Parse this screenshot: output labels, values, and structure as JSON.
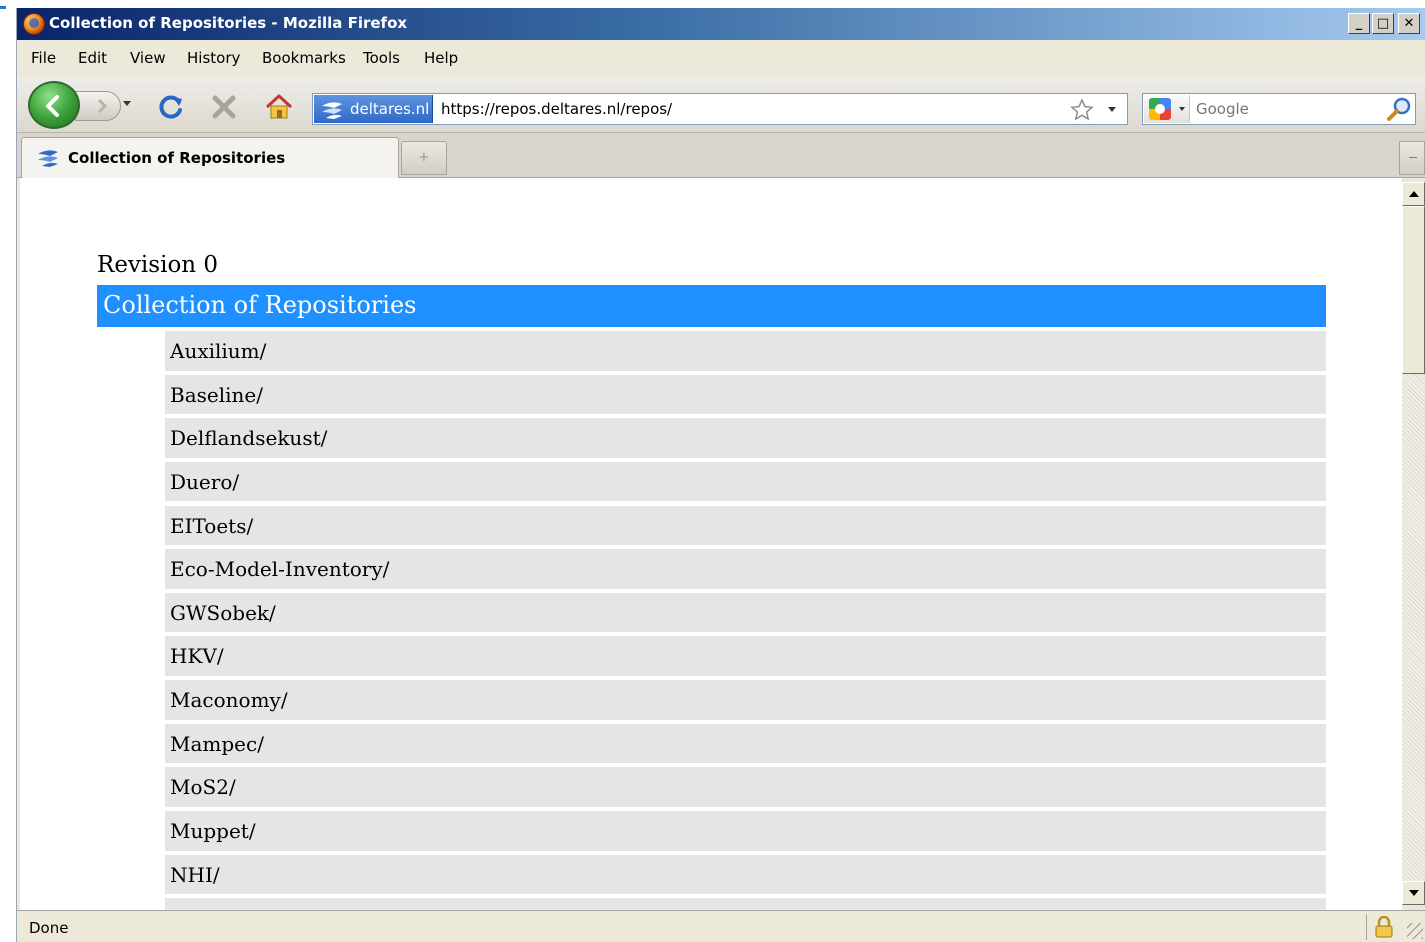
{
  "window": {
    "title": "Collection of Repositories - Mozilla Firefox",
    "controls": {
      "minimize": "_",
      "maximize": "□",
      "close": "✕"
    }
  },
  "menu": {
    "items": [
      "File",
      "Edit",
      "View",
      "History",
      "Bookmarks",
      "Tools",
      "Help"
    ]
  },
  "navigation": {
    "back_icon": "back-arrow-icon",
    "forward_icon": "forward-arrow-icon",
    "reload_icon": "reload-icon",
    "stop_icon": "stop-icon",
    "home_icon": "home-icon",
    "site_identity": "deltares.nl",
    "url": "https://repos.deltares.nl/repos/",
    "bookmark_icon": "star-icon",
    "search_engine_icon": "google-icon",
    "search_placeholder": "Google",
    "search_go_icon": "magnifier-icon"
  },
  "tabs": {
    "active_label": "Collection of Repositories",
    "new_tab": "+"
  },
  "page": {
    "revision": "Revision 0",
    "header": "Collection of Repositories",
    "repositories": [
      "Auxilium/",
      "Baseline/",
      "Delflandsekust/",
      "Duero/",
      "EIToets/",
      "Eco-Model-Inventory/",
      "GWSobek/",
      "HKV/",
      "Maconomy/",
      "Mampec/",
      "MoS2/",
      "Muppet/",
      "NHI/"
    ]
  },
  "status": {
    "text": "Done",
    "lock_icon": "padlock-icon"
  },
  "colors": {
    "header_bg": "#1e90ff",
    "row_bg": "#e5e5e5",
    "titlebar_start": "#0a246a",
    "titlebar_end": "#a6caf0"
  }
}
